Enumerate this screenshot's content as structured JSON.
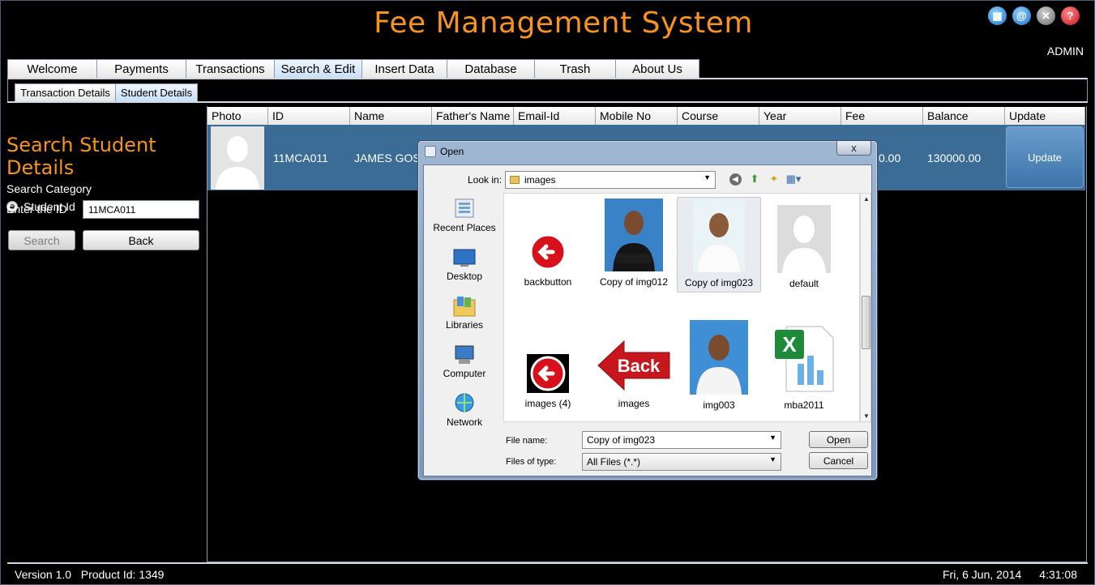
{
  "app": {
    "title": "Fee Management System",
    "user": "ADMIN",
    "icons": [
      "grid-icon",
      "at-icon",
      "close-icon",
      "help-icon"
    ]
  },
  "main_tabs": [
    {
      "label": "Welcome",
      "active": false
    },
    {
      "label": "Payments",
      "active": false
    },
    {
      "label": "Transactions",
      "active": false
    },
    {
      "label": "Search & Edit",
      "active": true
    },
    {
      "label": "Insert Data",
      "active": false
    },
    {
      "label": "Database",
      "active": false
    },
    {
      "label": "Trash",
      "active": false
    },
    {
      "label": "About Us",
      "active": false
    }
  ],
  "sub_tabs": [
    {
      "label": "Transaction Details",
      "active": false
    },
    {
      "label": "Student Details",
      "active": true
    }
  ],
  "search_panel": {
    "title": "Search Student Details",
    "category_label": "Search Category",
    "radio_label": "Student Id",
    "id_label": "Enter the ID",
    "id_value": "11MCA011",
    "search_label": "Search",
    "back_label": "Back"
  },
  "table": {
    "columns": [
      "Photo",
      "ID",
      "Name",
      "Father's Name",
      "Email-Id",
      "Mobile No",
      "Course",
      "Year",
      "Fee",
      "Balance",
      "Update"
    ],
    "row": {
      "id": "11MCA011",
      "name": "JAMES GOSL",
      "fee": "0.00",
      "balance": "130000.00",
      "update_label": "Update"
    }
  },
  "dialog": {
    "title": "Open",
    "close_label": "x",
    "look_in_label": "Look in:",
    "look_in_value": "images",
    "places": [
      "Recent Places",
      "Desktop",
      "Libraries",
      "Computer",
      "Network"
    ],
    "files": [
      {
        "name": "backbutton",
        "kind": "red-back-arrow-icon"
      },
      {
        "name": "Copy of img012",
        "kind": "photo"
      },
      {
        "name": "Copy of img023",
        "kind": "photo",
        "selected": true
      },
      {
        "name": "default",
        "kind": "silhouette"
      },
      {
        "name": "images (4)",
        "kind": "red-back-arrow-icon"
      },
      {
        "name": "images",
        "kind": "back-sign"
      },
      {
        "name": "img003",
        "kind": "photo"
      },
      {
        "name": "mba2011",
        "kind": "excel-icon"
      }
    ],
    "file_name_label": "File name:",
    "file_name_value": "Copy of img023",
    "files_of_type_label": "Files of type:",
    "files_of_type_value": "All Files (*.*)",
    "open_label": "Open",
    "cancel_label": "Cancel"
  },
  "status": {
    "version": "Version 1.0",
    "product_id": "Product Id: 1349",
    "date": "Fri, 6 Jun, 2014",
    "time": "4:31:08"
  }
}
